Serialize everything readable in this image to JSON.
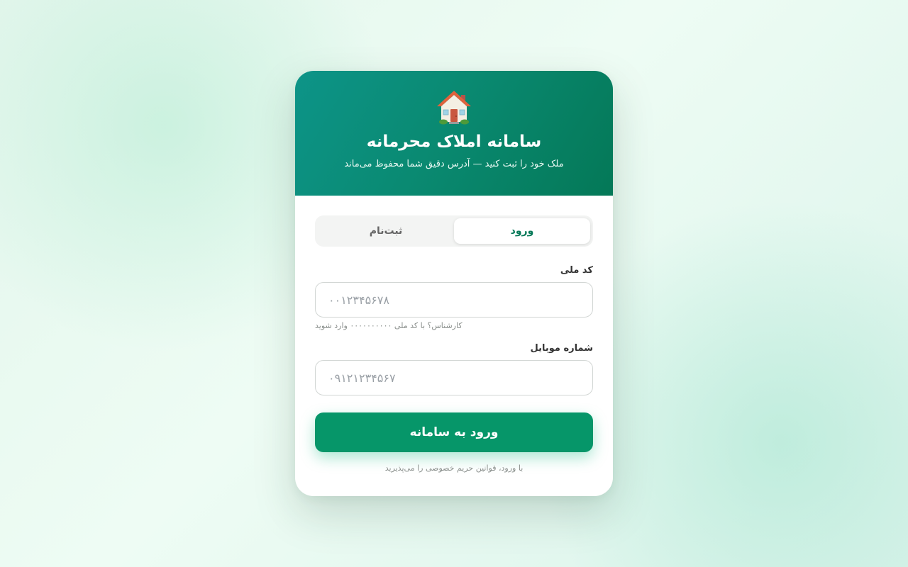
{
  "header": {
    "logo_icon": "house-icon",
    "title": "سامانه املاک محرمانه",
    "subtitle": "ملک خود را ثبت کنید — آدرس دقیق شما محفوظ می‌ماند"
  },
  "tabs": [
    {
      "label": "ورود",
      "active": true
    },
    {
      "label": "ثبت‌نام",
      "active": false
    }
  ],
  "form": {
    "national_code": {
      "label": "کد ملی",
      "placeholder": "۰۰۱۲۳۴۵۶۷۸",
      "value": "",
      "hint": "کارشناس؟ با کد ملی ۰۰۰۰۰۰۰۰۰۰ وارد شوید"
    },
    "mobile": {
      "label": "شماره موبایل",
      "placeholder": "۰۹۱۲۱۲۳۴۵۶۷",
      "value": ""
    },
    "submit_label": "ورود به سامانه",
    "terms": "با ورود، قوانین حریم خصوصی را می‌پذیرید"
  },
  "colors": {
    "primary": "#069669",
    "header_start": "#0d9488",
    "header_end": "#047857"
  }
}
